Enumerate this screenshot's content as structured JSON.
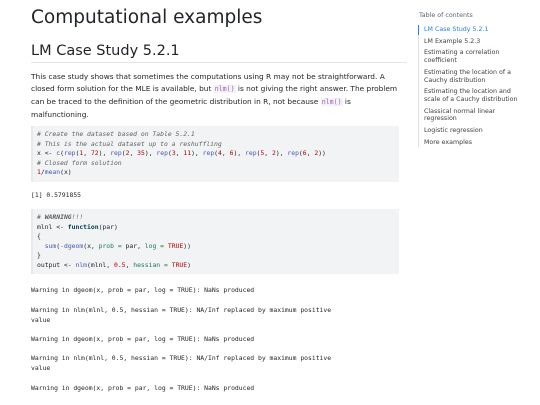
{
  "page": {
    "title": "Computational examples"
  },
  "section": {
    "title": "LM Case Study 5.2.1",
    "para_part1": "This case study shows that sometimes the computations using R may not be straightforward. A closed form solution for the MLE is available, but ",
    "para_code1": "nlm()",
    "para_part2": " is not giving the right answer. The problem can be traced to the definition of the geometric distribution in R, not because ",
    "para_code2": "nlm()",
    "para_part3": " is malfunctioning."
  },
  "code1": {
    "line1": "# Create the dataset based on Table 5.2.1",
    "line2": "# This is the actual dataset up to a reshuffling",
    "line3_a": "x <- ",
    "line3_fn1": "c",
    "line3_b": "(",
    "line3_fn2": "rep",
    "line3_c": "(",
    "line3_n1": "1",
    "line3_d": ", ",
    "line3_n2": "72",
    "line3_e": "), ",
    "line3_fn3": "rep",
    "line3_f": "(",
    "line3_n3": "2",
    "line3_g": ", ",
    "line3_n4": "35",
    "line3_h": "), ",
    "line3_fn4": "rep",
    "line3_i": "(",
    "line3_n5": "3",
    "line3_j": ", ",
    "line3_n6": "11",
    "line3_k": "), ",
    "line3_fn5": "rep",
    "line3_l": "(",
    "line3_n7": "4",
    "line3_m": ", ",
    "line3_n8": "6",
    "line3_n": "), ",
    "line3_fn6": "rep",
    "line3_o": "(",
    "line3_n9": "5",
    "line3_p": ", ",
    "line3_n10": "2",
    "line3_q": "), ",
    "line3_fn7": "rep",
    "line3_r": "(",
    "line3_n11": "6",
    "line3_s": ", ",
    "line3_n12": "2",
    "line3_t": "))",
    "line4": "# Closed form solution",
    "line5_n": "1",
    "line5_a": "/",
    "line5_fn": "mean",
    "line5_b": "(x)"
  },
  "output1": "[1] 0.5791855",
  "code2": {
    "c1_hash": "# ",
    "c1_warn": "WARNING",
    "c1_rest": "!!!",
    "l2_a": "mlnl <- ",
    "l2_kw": "function",
    "l2_b": "(par)",
    "l3": "{",
    "l4_a": "  ",
    "l4_b": "sum",
    "l4_c": "(",
    "l4_d": "-",
    "l4_e": "dgeom",
    "l4_f": "(x, ",
    "l4_g": "prob =",
    "l4_h": " par, ",
    "l4_i": "log =",
    "l4_j": " ",
    "l4_k": "TRUE",
    "l4_l": "))",
    "l5": "}",
    "l6_a": "output <- ",
    "l6_fn": "nlm",
    "l6_b": "(mlnl, ",
    "l6_n": "0.5",
    "l6_c": ", ",
    "l6_d": "hessian =",
    "l6_e": " ",
    "l6_f": "TRUE",
    "l6_g": ")"
  },
  "warnings": [
    "Warning in dgeom(x, prob = par, log = TRUE): NaNs produced",
    "Warning in nlm(mlnl, 0.5, hessian = TRUE): NA/Inf replaced by maximum positive\nvalue",
    "Warning in dgeom(x, prob = par, log = TRUE): NaNs produced",
    "Warning in nlm(mlnl, 0.5, hessian = TRUE): NA/Inf replaced by maximum positive\nvalue",
    "Warning in dgeom(x, prob = par, log = TRUE): NaNs produced"
  ],
  "toc": {
    "title": "Table of contents",
    "items": [
      "LM Case Study 5.2.1",
      "LM Example 5.2.3",
      "Estimating a correlation coefficient",
      "Estimating the location of a Cauchy distribution",
      "Estimating the location and scale of a Cauchy distribution",
      "Classical normal linear regression",
      "Logistic regression",
      "More examples"
    ],
    "active_index": 0,
    "colors": {
      "active": "#2780e3"
    }
  }
}
